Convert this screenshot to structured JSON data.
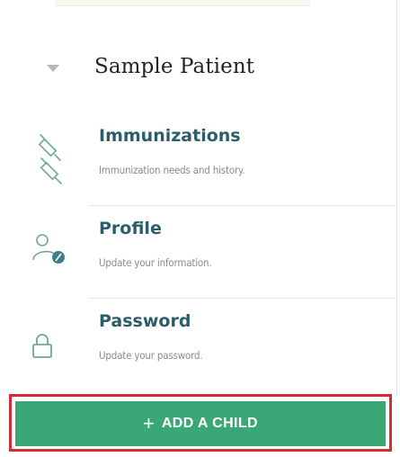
{
  "patient": {
    "name": "Sample Patient"
  },
  "menu": [
    {
      "title": "Immunizations",
      "subtitle": "Immunization needs and history.",
      "icon": "syringe-icon"
    },
    {
      "title": "Profile",
      "subtitle": "Update your information.",
      "icon": "profile-edit-icon"
    },
    {
      "title": "Password",
      "subtitle": "Update your password.",
      "icon": "lock-icon"
    }
  ],
  "add_child": {
    "plus": "+",
    "label": "ADD A CHILD"
  },
  "colors": {
    "accent": "#3aa876",
    "title": "#2b5d6b",
    "highlight_border": "#d62a35",
    "icon": "#6fa89a"
  }
}
